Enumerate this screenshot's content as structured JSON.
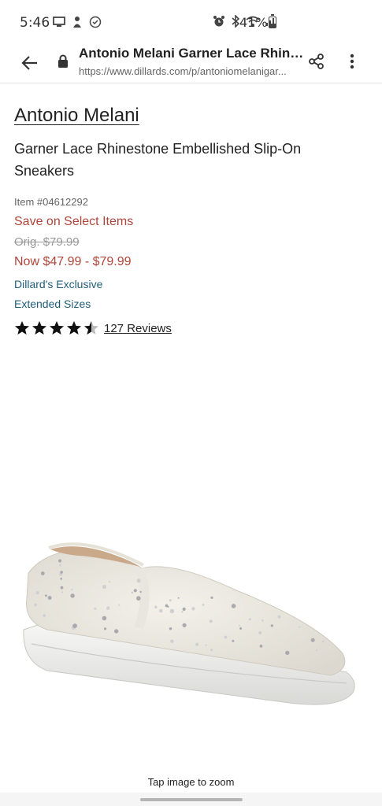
{
  "status": {
    "time": "5:46",
    "battery_pct": "41%",
    "battery_level": 0.41
  },
  "browser": {
    "page_title": "Antonio Melani Garner Lace Rhine...",
    "url": "https://www.dillards.com/p/antoniomelanigar..."
  },
  "product": {
    "brand": "Antonio Melani",
    "title": "Garner Lace Rhinestone Embellished Slip-On Sneakers",
    "item_number": "Item #04612292",
    "promo": "Save on Select Items",
    "orig_price": "Orig. $79.99",
    "now_price": "Now $47.99 - $79.99",
    "exclusive_label": "Dillard's Exclusive",
    "sizes_label": "Extended Sizes",
    "rating_value": 4.5,
    "reviews_label": "127 Reviews"
  },
  "image": {
    "zoom_hint": "Tap image to zoom"
  },
  "colors": {
    "sale_red": "#b0453a",
    "link_teal": "#1f5e7a"
  }
}
